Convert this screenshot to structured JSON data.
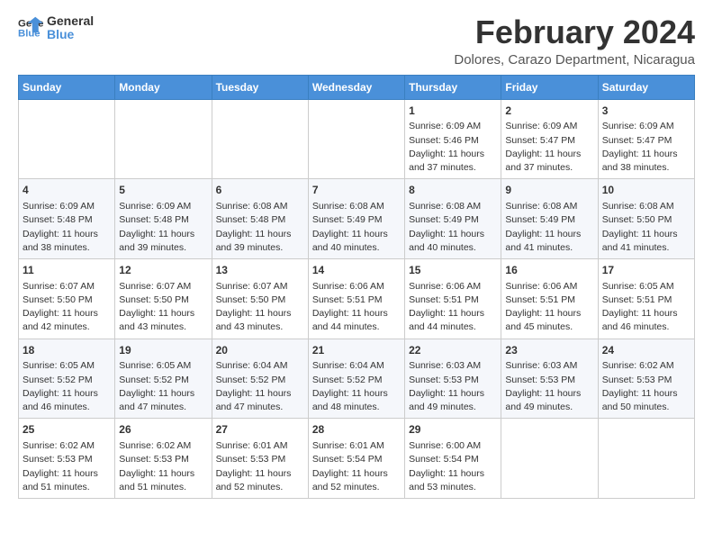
{
  "logo": {
    "line1": "General",
    "line2": "Blue"
  },
  "title": "February 2024",
  "subtitle": "Dolores, Carazo Department, Nicaragua",
  "weekdays": [
    "Sunday",
    "Monday",
    "Tuesday",
    "Wednesday",
    "Thursday",
    "Friday",
    "Saturday"
  ],
  "weeks": [
    [
      {
        "day": "",
        "info": ""
      },
      {
        "day": "",
        "info": ""
      },
      {
        "day": "",
        "info": ""
      },
      {
        "day": "",
        "info": ""
      },
      {
        "day": "1",
        "info": "Sunrise: 6:09 AM\nSunset: 5:46 PM\nDaylight: 11 hours and 37 minutes."
      },
      {
        "day": "2",
        "info": "Sunrise: 6:09 AM\nSunset: 5:47 PM\nDaylight: 11 hours and 37 minutes."
      },
      {
        "day": "3",
        "info": "Sunrise: 6:09 AM\nSunset: 5:47 PM\nDaylight: 11 hours and 38 minutes."
      }
    ],
    [
      {
        "day": "4",
        "info": "Sunrise: 6:09 AM\nSunset: 5:48 PM\nDaylight: 11 hours and 38 minutes."
      },
      {
        "day": "5",
        "info": "Sunrise: 6:09 AM\nSunset: 5:48 PM\nDaylight: 11 hours and 39 minutes."
      },
      {
        "day": "6",
        "info": "Sunrise: 6:08 AM\nSunset: 5:48 PM\nDaylight: 11 hours and 39 minutes."
      },
      {
        "day": "7",
        "info": "Sunrise: 6:08 AM\nSunset: 5:49 PM\nDaylight: 11 hours and 40 minutes."
      },
      {
        "day": "8",
        "info": "Sunrise: 6:08 AM\nSunset: 5:49 PM\nDaylight: 11 hours and 40 minutes."
      },
      {
        "day": "9",
        "info": "Sunrise: 6:08 AM\nSunset: 5:49 PM\nDaylight: 11 hours and 41 minutes."
      },
      {
        "day": "10",
        "info": "Sunrise: 6:08 AM\nSunset: 5:50 PM\nDaylight: 11 hours and 41 minutes."
      }
    ],
    [
      {
        "day": "11",
        "info": "Sunrise: 6:07 AM\nSunset: 5:50 PM\nDaylight: 11 hours and 42 minutes."
      },
      {
        "day": "12",
        "info": "Sunrise: 6:07 AM\nSunset: 5:50 PM\nDaylight: 11 hours and 43 minutes."
      },
      {
        "day": "13",
        "info": "Sunrise: 6:07 AM\nSunset: 5:50 PM\nDaylight: 11 hours and 43 minutes."
      },
      {
        "day": "14",
        "info": "Sunrise: 6:06 AM\nSunset: 5:51 PM\nDaylight: 11 hours and 44 minutes."
      },
      {
        "day": "15",
        "info": "Sunrise: 6:06 AM\nSunset: 5:51 PM\nDaylight: 11 hours and 44 minutes."
      },
      {
        "day": "16",
        "info": "Sunrise: 6:06 AM\nSunset: 5:51 PM\nDaylight: 11 hours and 45 minutes."
      },
      {
        "day": "17",
        "info": "Sunrise: 6:05 AM\nSunset: 5:51 PM\nDaylight: 11 hours and 46 minutes."
      }
    ],
    [
      {
        "day": "18",
        "info": "Sunrise: 6:05 AM\nSunset: 5:52 PM\nDaylight: 11 hours and 46 minutes."
      },
      {
        "day": "19",
        "info": "Sunrise: 6:05 AM\nSunset: 5:52 PM\nDaylight: 11 hours and 47 minutes."
      },
      {
        "day": "20",
        "info": "Sunrise: 6:04 AM\nSunset: 5:52 PM\nDaylight: 11 hours and 47 minutes."
      },
      {
        "day": "21",
        "info": "Sunrise: 6:04 AM\nSunset: 5:52 PM\nDaylight: 11 hours and 48 minutes."
      },
      {
        "day": "22",
        "info": "Sunrise: 6:03 AM\nSunset: 5:53 PM\nDaylight: 11 hours and 49 minutes."
      },
      {
        "day": "23",
        "info": "Sunrise: 6:03 AM\nSunset: 5:53 PM\nDaylight: 11 hours and 49 minutes."
      },
      {
        "day": "24",
        "info": "Sunrise: 6:02 AM\nSunset: 5:53 PM\nDaylight: 11 hours and 50 minutes."
      }
    ],
    [
      {
        "day": "25",
        "info": "Sunrise: 6:02 AM\nSunset: 5:53 PM\nDaylight: 11 hours and 51 minutes."
      },
      {
        "day": "26",
        "info": "Sunrise: 6:02 AM\nSunset: 5:53 PM\nDaylight: 11 hours and 51 minutes."
      },
      {
        "day": "27",
        "info": "Sunrise: 6:01 AM\nSunset: 5:53 PM\nDaylight: 11 hours and 52 minutes."
      },
      {
        "day": "28",
        "info": "Sunrise: 6:01 AM\nSunset: 5:54 PM\nDaylight: 11 hours and 52 minutes."
      },
      {
        "day": "29",
        "info": "Sunrise: 6:00 AM\nSunset: 5:54 PM\nDaylight: 11 hours and 53 minutes."
      },
      {
        "day": "",
        "info": ""
      },
      {
        "day": "",
        "info": ""
      }
    ]
  ]
}
